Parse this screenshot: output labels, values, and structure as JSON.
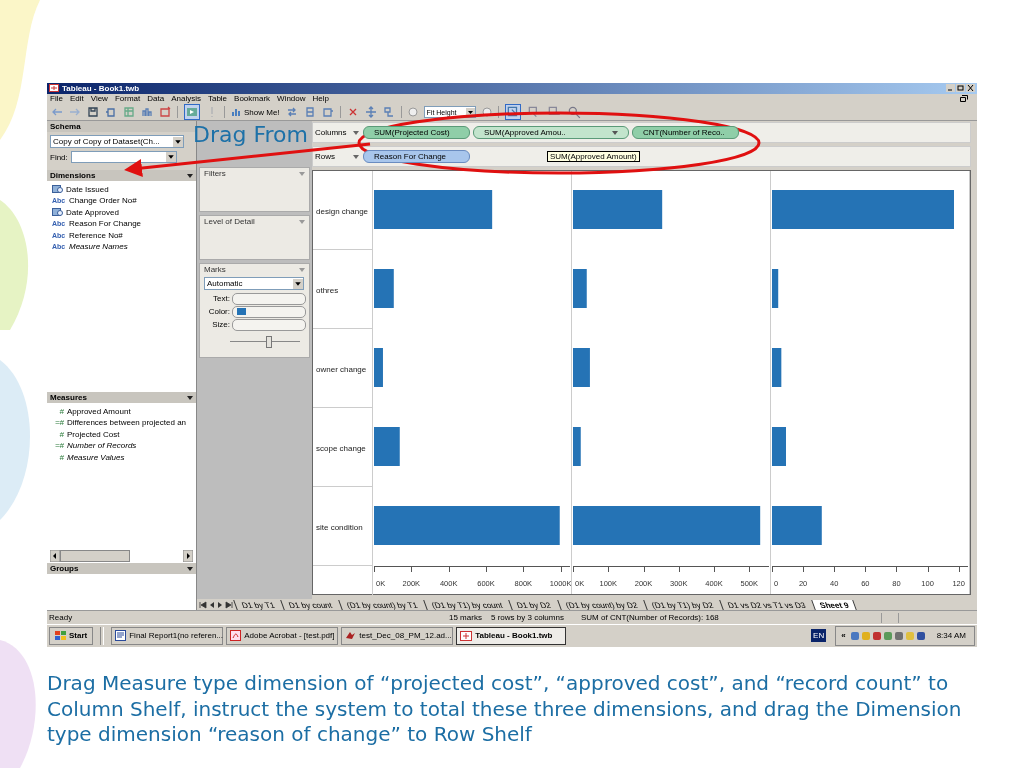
{
  "window": {
    "title": "Tableau - Book1.twb"
  },
  "menu": [
    "File",
    "Edit",
    "View",
    "Format",
    "Data",
    "Analysis",
    "Table",
    "Bookmark",
    "Window",
    "Help"
  ],
  "toolbar": {
    "show_me": "Show Me!",
    "fit": "Fit Height"
  },
  "schema": {
    "header": "Schema",
    "datasource": "Copy of Copy of Dataset(Ch...",
    "find_label": "Find:"
  },
  "dimensions": {
    "header": "Dimensions",
    "items": [
      {
        "label": "Date  Issued",
        "kind": "date",
        "italic": false
      },
      {
        "label": "Change Order No#",
        "kind": "string",
        "glyph": "Abc",
        "italic": false
      },
      {
        "label": "Date Approved",
        "kind": "date",
        "italic": false
      },
      {
        "label": "Reason For Change",
        "kind": "string",
        "glyph": "Abc",
        "italic": false
      },
      {
        "label": "Reference No#",
        "kind": "string",
        "glyph": "Abc",
        "italic": false
      },
      {
        "label": "Measure Names",
        "kind": "string",
        "glyph": "Abc",
        "italic": true
      }
    ]
  },
  "measures": {
    "header": "Measures",
    "items": [
      {
        "label": "Approved Amount",
        "glyph": "#",
        "italic": false
      },
      {
        "label": "Differences between projected an",
        "glyph": "=#",
        "italic": false
      },
      {
        "label": "Projected Cost",
        "glyph": "#",
        "italic": false
      },
      {
        "label": "Number of Records",
        "glyph": "=#",
        "italic": true
      },
      {
        "label": "Measure Values",
        "glyph": "#",
        "italic": true
      }
    ]
  },
  "groups": {
    "header": "Groups"
  },
  "cards": {
    "filters": "Filters",
    "level_of_detail": "Level of Detail",
    "marks": {
      "header": "Marks",
      "type": "Automatic",
      "shelves": [
        "Text:",
        "Color:",
        "Size:"
      ],
      "size_slider": {
        "level": 0.55
      }
    }
  },
  "shelves": [
    {
      "label": "Columns",
      "pills": [
        {
          "label": "SUM(Projected Cost)",
          "kind": "measure",
          "selected": false
        },
        {
          "label": "SUM(Approved Amou..",
          "kind": "measure",
          "selected": true
        },
        {
          "label": "CNT(Number of Reco..",
          "kind": "measure",
          "selected": false
        }
      ]
    },
    {
      "label": "Rows",
      "pills": [
        {
          "label": "Reason For Change",
          "kind": "dimension",
          "selected": false
        }
      ]
    }
  ],
  "tooltip": "SUM(Approved Amount)",
  "view": {
    "charts": [
      {
        "chart_data": {
          "type": "bar",
          "orientation": "horizontal",
          "categories": [
            "design change",
            "othres",
            "owner change",
            "scope change",
            "site condition"
          ],
          "values": [
            633000,
            106000,
            48000,
            138000,
            995000
          ],
          "xlim": [
            0,
            1050000
          ],
          "xticks": [
            {
              "value": 0,
              "label": "0K"
            },
            {
              "value": 200000,
              "label": "200K"
            },
            {
              "value": 400000,
              "label": "400K"
            },
            {
              "value": 600000,
              "label": "600K"
            },
            {
              "value": 800000,
              "label": "800K"
            },
            {
              "value": 1000000,
              "label": "1000K"
            }
          ]
        }
      },
      {
        "chart_data": {
          "type": "bar",
          "orientation": "horizontal",
          "values": [
            253000,
            39000,
            48000,
            22000,
            531000
          ],
          "xlim": [
            0,
            556000
          ],
          "xticks": [
            {
              "value": 0,
              "label": "0K"
            },
            {
              "value": 100000,
              "label": "100K"
            },
            {
              "value": 200000,
              "label": "200K"
            },
            {
              "value": 300000,
              "label": "300K"
            },
            {
              "value": 400000,
              "label": "400K"
            },
            {
              "value": 500000,
              "label": "500K"
            }
          ]
        }
      },
      {
        "chart_data": {
          "type": "bar",
          "orientation": "horizontal",
          "values": [
            117,
            4,
            6,
            9,
            32
          ],
          "xlim": [
            0,
            126
          ],
          "xticks": [
            0,
            20,
            40,
            60,
            80,
            100,
            120
          ]
        }
      }
    ]
  },
  "sheet_tabs": [
    {
      "label": "D1 by T1",
      "selected": false
    },
    {
      "label": "D1 by count",
      "selected": false
    },
    {
      "label": "(D1 by count) by T1",
      "selected": false
    },
    {
      "label": "(D1 by T1) by count",
      "selected": false
    },
    {
      "label": "D1 by D2",
      "selected": false
    },
    {
      "label": "(D1 by count) by  D2",
      "selected": false
    },
    {
      "label": "(D1 by T1) by D2",
      "selected": false
    },
    {
      "label": "D1 vs D2 vs T1 vs D3",
      "selected": false
    },
    {
      "label": "Sheet 9",
      "selected": true
    }
  ],
  "status_bar": {
    "state": "Ready",
    "marks": "15 marks",
    "dimensions": "5 rows by 3 columns",
    "sum": "SUM of CNT(Number of Records): 168"
  },
  "taskbar": {
    "start": "Start",
    "tasks": [
      {
        "label": "Final Report1(no referen...",
        "kind": "word",
        "selected": false
      },
      {
        "label": "Adobe Acrobat - [test.pdf]",
        "kind": "pdf",
        "selected": false
      },
      {
        "label": "test_Dec_08_PM_12.ad...",
        "kind": "media",
        "selected": false
      },
      {
        "label": "Tableau - Book1.twb",
        "kind": "tableau",
        "selected": true
      }
    ],
    "language": "EN",
    "tray_expand": "«",
    "clock": "8:34 AM"
  },
  "annotation": {
    "label": "Drag From"
  },
  "caption": "Drag Measure type dimension of “projected cost”, “approved cost”, and “record count” to Column Shelf, instruct the system to total these three dimensions, and drag the Dimension type dimension “reason of change” to Row Shelf"
}
